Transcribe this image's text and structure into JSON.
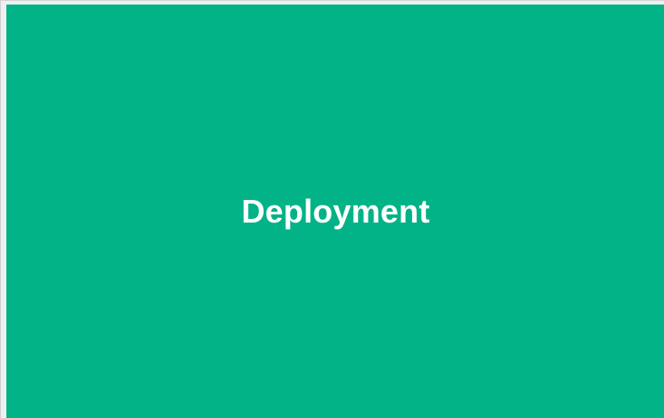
{
  "tile": {
    "title": "Deployment",
    "background_color": "#03b388",
    "text_color": "#ffffff"
  }
}
